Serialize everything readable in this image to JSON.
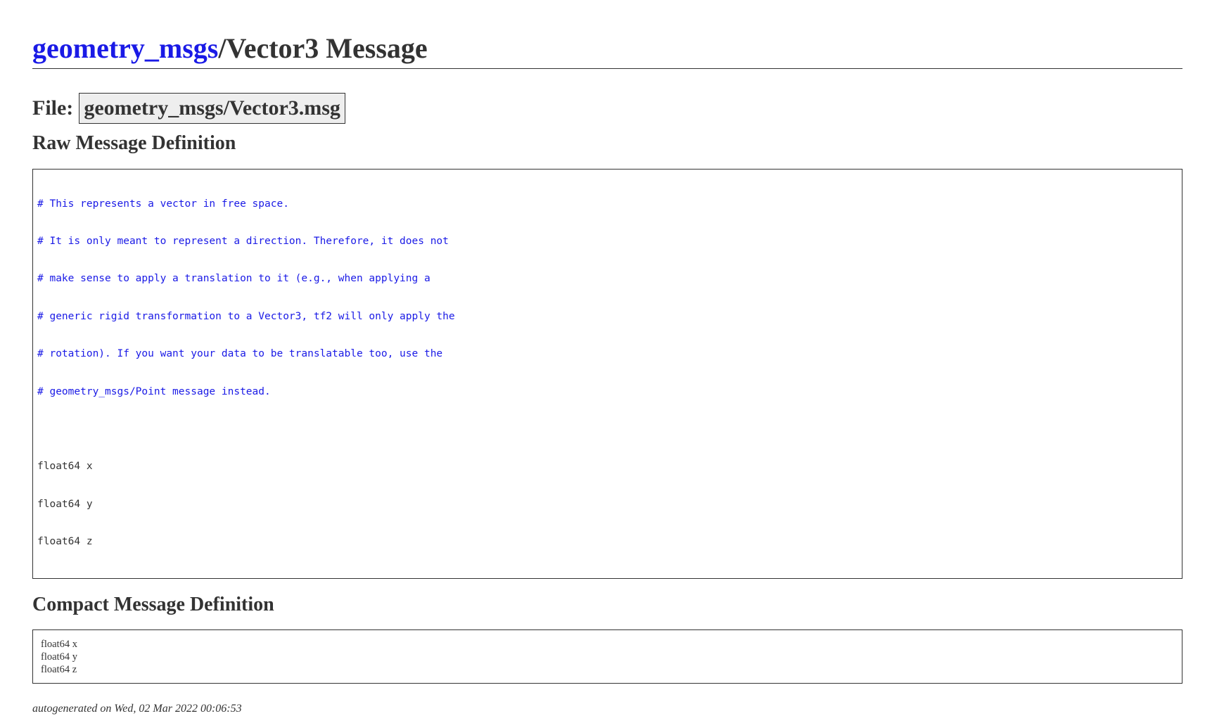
{
  "header": {
    "package_link": "geometry_msgs",
    "title_rest": "/Vector3 Message"
  },
  "file": {
    "label": "File:",
    "path": "geometry_msgs/Vector3.msg"
  },
  "raw": {
    "heading": "Raw Message Definition",
    "comments": [
      "# This represents a vector in free space.",
      "# It is only meant to represent a direction. Therefore, it does not",
      "# make sense to apply a translation to it (e.g., when applying a",
      "# generic rigid transformation to a Vector3, tf2 will only apply the",
      "# rotation). If you want your data to be translatable too, use the",
      "# geometry_msgs/Point message instead."
    ],
    "fields": [
      "float64 x",
      "float64 y",
      "float64 z"
    ]
  },
  "compact": {
    "heading": "Compact Message Definition",
    "fields": [
      "float64 x",
      "float64 y",
      "float64 z"
    ]
  },
  "footer": {
    "text": "autogenerated on Wed, 02 Mar 2022 00:06:53"
  },
  "colors": {
    "link": "#1a1ae6",
    "text": "#333333",
    "file_box_bg": "#eeeeee"
  }
}
